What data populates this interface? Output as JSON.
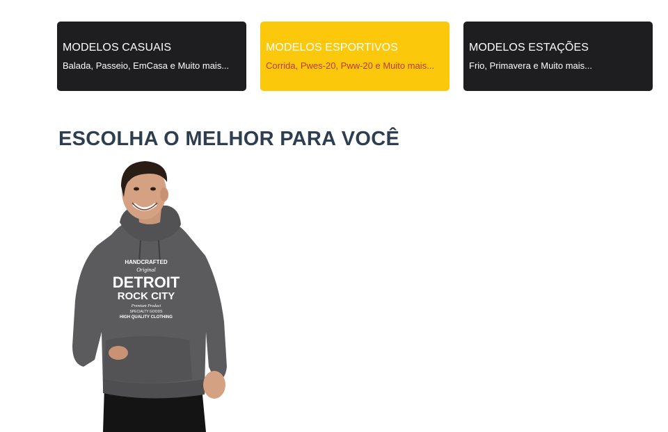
{
  "categories": [
    {
      "title": "MODELOS CASUAIS",
      "description": "Balada, Passeio, EmCasa e Muito mais...",
      "active": false
    },
    {
      "title": "MODELOS ESPORTIVOS",
      "description": "Corrida, Pwes-20, Pww-20 e Muito mais...",
      "active": true
    },
    {
      "title": "MODELOS ESTAÇÕES",
      "description": "Frio, Primavera e Muito mais...",
      "active": false
    }
  ],
  "section": {
    "heading": "ESCOLHA O MELHOR PARA VOCÊ"
  },
  "product": {
    "print_line1": "HANDCRAFTED",
    "print_line2": "Original",
    "print_line3": "DETROIT",
    "print_line4": "ROCK CITY",
    "print_line5": "Premium Product",
    "print_line6": "SPECIALTY GOODS",
    "print_line7": "HIGH QUALITY CLOTHING"
  },
  "colors": {
    "card_dark": "#1e1e20",
    "card_accent": "#fcc80b",
    "accent_text": "#c0392b",
    "heading": "#2c3e50",
    "hoodie": "#5b5a5c"
  }
}
